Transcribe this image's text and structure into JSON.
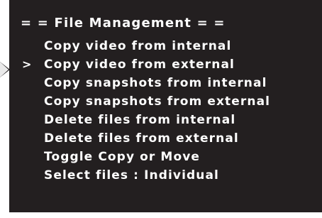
{
  "menu": {
    "title": "= = File Management = =",
    "cursor_glyph": ">",
    "selected_index": 1,
    "items": [
      {
        "label": "Copy video from internal"
      },
      {
        "label": "Copy video from external"
      },
      {
        "label": "Copy snapshots from internal"
      },
      {
        "label": "Copy snapshots from external"
      },
      {
        "label": "Delete files from internal"
      },
      {
        "label": "Delete files from external"
      },
      {
        "label": "Toggle Copy or Move"
      },
      {
        "label": "Select files : Individual"
      }
    ]
  },
  "colors": {
    "background": "#231f20",
    "text": "#ffffff",
    "pointer": "#e9e9e9"
  }
}
